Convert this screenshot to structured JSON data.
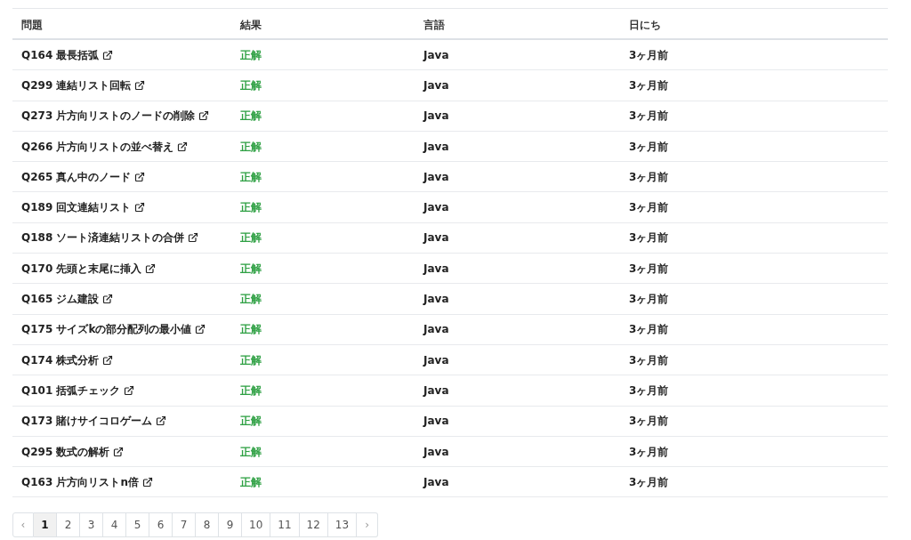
{
  "table": {
    "columns": [
      "問題",
      "結果",
      "言語",
      "日にち"
    ],
    "rows": [
      {
        "problem": "Q164 最長括弧",
        "result": "正解",
        "language": "Java",
        "date": "3ヶ月前"
      },
      {
        "problem": "Q299 連結リスト回転",
        "result": "正解",
        "language": "Java",
        "date": "3ヶ月前"
      },
      {
        "problem": "Q273 片方向リストのノードの削除",
        "result": "正解",
        "language": "Java",
        "date": "3ヶ月前"
      },
      {
        "problem": "Q266 片方向リストの並べ替え",
        "result": "正解",
        "language": "Java",
        "date": "3ヶ月前"
      },
      {
        "problem": "Q265 真ん中のノード",
        "result": "正解",
        "language": "Java",
        "date": "3ヶ月前"
      },
      {
        "problem": "Q189 回文連結リスト",
        "result": "正解",
        "language": "Java",
        "date": "3ヶ月前"
      },
      {
        "problem": "Q188 ソート済連結リストの合併",
        "result": "正解",
        "language": "Java",
        "date": "3ヶ月前"
      },
      {
        "problem": "Q170 先頭と末尾に挿入",
        "result": "正解",
        "language": "Java",
        "date": "3ヶ月前"
      },
      {
        "problem": "Q165 ジム建設",
        "result": "正解",
        "language": "Java",
        "date": "3ヶ月前"
      },
      {
        "problem": "Q175 サイズkの部分配列の最小値",
        "result": "正解",
        "language": "Java",
        "date": "3ヶ月前"
      },
      {
        "problem": "Q174 株式分析",
        "result": "正解",
        "language": "Java",
        "date": "3ヶ月前"
      },
      {
        "problem": "Q101 括弧チェック",
        "result": "正解",
        "language": "Java",
        "date": "3ヶ月前"
      },
      {
        "problem": "Q173 賭けサイコロゲーム",
        "result": "正解",
        "language": "Java",
        "date": "3ヶ月前"
      },
      {
        "problem": "Q295 数式の解析",
        "result": "正解",
        "language": "Java",
        "date": "3ヶ月前"
      },
      {
        "problem": "Q163 片方向リストn倍",
        "result": "正解",
        "language": "Java",
        "date": "3ヶ月前"
      }
    ]
  },
  "pagination": {
    "previous": "‹",
    "next": "›",
    "pages": [
      {
        "label": "1",
        "selected": true
      },
      {
        "label": "2",
        "selected": false
      },
      {
        "label": "3",
        "selected": false
      },
      {
        "label": "4",
        "selected": false
      },
      {
        "label": "5",
        "selected": false
      },
      {
        "label": "6",
        "selected": false
      },
      {
        "label": "7",
        "selected": false
      },
      {
        "label": "8",
        "selected": false
      },
      {
        "label": "9",
        "selected": false
      },
      {
        "label": "10",
        "selected": false
      },
      {
        "label": "11",
        "selected": false
      },
      {
        "label": "12",
        "selected": false
      },
      {
        "label": "13",
        "selected": false
      }
    ]
  }
}
